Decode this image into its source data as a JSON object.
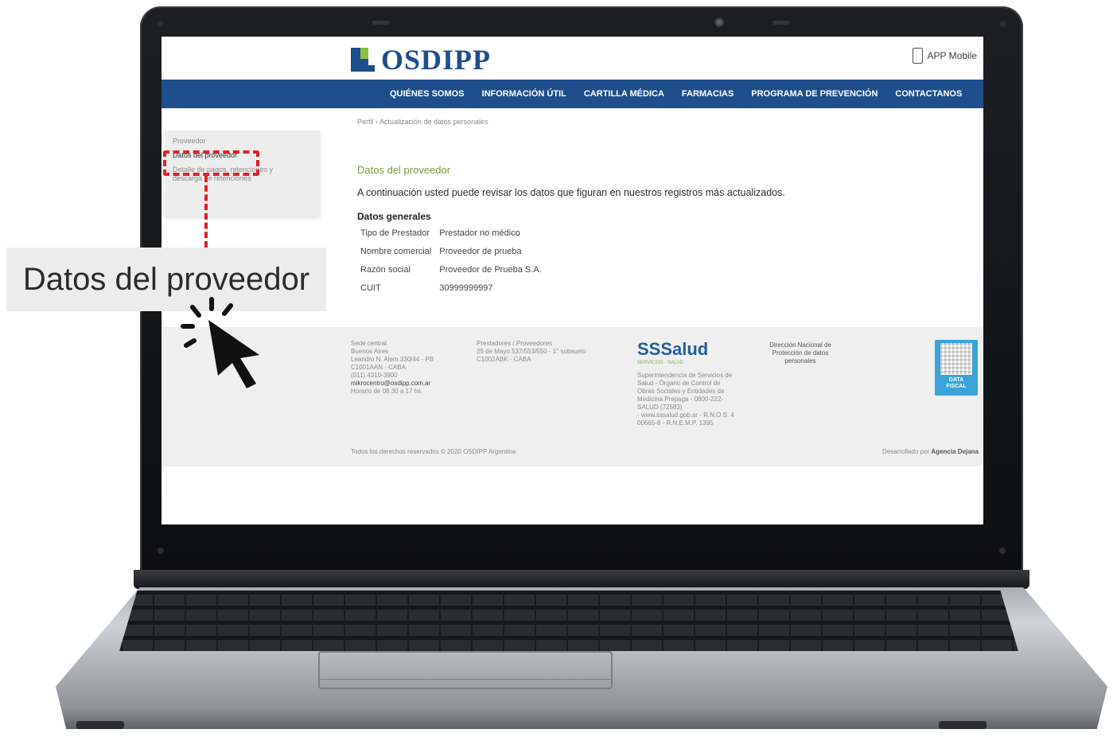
{
  "site": {
    "logo_text": "OSDIPP",
    "app_mobile": "APP Mobile"
  },
  "nav": {
    "items": [
      "QUIÉNES SOMOS",
      "INFORMACIÓN ÚTIL",
      "CARTILLA MÉDICA",
      "FARMACIAS",
      "PROGRAMA DE PREVENCIÓN",
      "CONTACTANOS"
    ]
  },
  "sidebar": {
    "items": [
      "Proveedor",
      "Datos del proveedor",
      "Detalle de pagos, retenciones y",
      "descarga de retenciones"
    ]
  },
  "main": {
    "breadcrumb": "Perfil › Actualización de datos personales",
    "section_title": "Datos del proveedor",
    "intro": "A continuación usted puede revisar los datos que figuran en nuestros registros más actualizados.",
    "group_title": "Datos generales",
    "rows": [
      {
        "label": "Tipo de Prestador",
        "value": "Prestador no médico"
      },
      {
        "label": "Nombre comercial",
        "value": "Proveedor de prueba"
      },
      {
        "label": "Razón social",
        "value": "Proveedor de Prueba S.A."
      },
      {
        "label": "CUIT",
        "value": "30999999997"
      }
    ]
  },
  "footer": {
    "col1": [
      "Sede central",
      "Buenos Aires",
      "Leandro N. Alem 330/44 - PB",
      "C1001AAN - CABA",
      "(011) 4310-3900"
    ],
    "col1_email": "mikrocentro@osdipp.com.ar",
    "col1_hours": "Horario de 08.30 a 17 hs.",
    "col2": [
      "Prestadores / Proveedores",
      "25 de Mayo 537/553/550 - 1° subsuelo",
      "C1002ABK - CABA"
    ],
    "ssalud_logo": "SSSalud",
    "ssalud_sub": "SERVICIOS · SALUD",
    "col3": [
      "Superintendencia de Servicios de",
      "Salud - Órgano de Control de",
      "Obras Sociales y Entidades de",
      "Medicina Prepaga - 0800-222-",
      "SALUD (72583)",
      "- www.sssalud.gob.ar - R.N.O.S. 4",
      "00665-8 - R.N.E.M.P. 1395"
    ],
    "col4": [
      "Dirección Nacional de",
      "Protección de datos",
      "personales"
    ],
    "data_fiscal": [
      "DATA",
      "FISCAL"
    ],
    "copyright": "Todos los derechos reservados © 2020 OSDIPP Argentina",
    "developer_prefix": "Desarrollado por ",
    "developer_name": "Agencia Dejana"
  },
  "callout": {
    "label": "Datos del proveedor"
  },
  "colors": {
    "brand_blue": "#1f4e8c",
    "brand_green": "#8cbf3f",
    "highlight_red": "#e0202a"
  },
  "icons": [
    "phone-icon",
    "osdipp-logo-icon",
    "qr-code-icon",
    "click-pointer-icon"
  ]
}
